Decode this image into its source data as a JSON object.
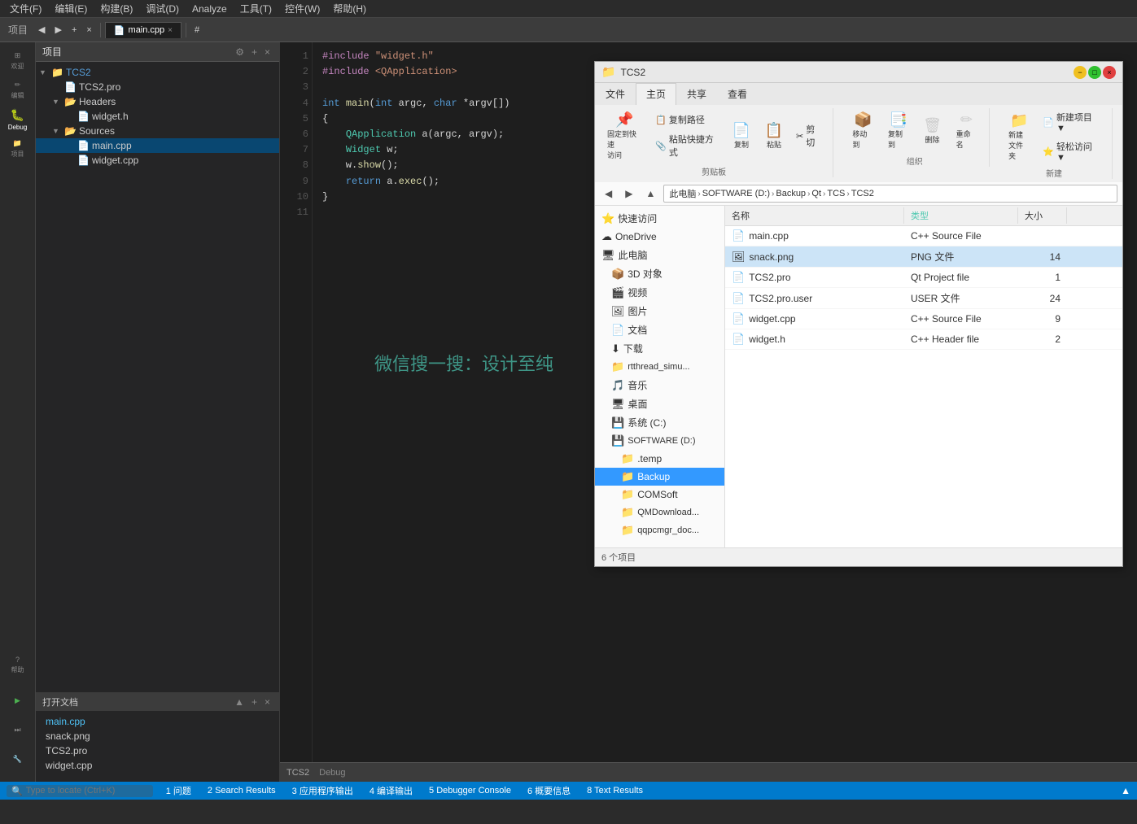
{
  "menubar": {
    "items": [
      "文件(F)",
      "编辑(E)",
      "构建(B)",
      "调试(D)",
      "Analyze",
      "工具(T)",
      "控件(W)",
      "帮助(H)"
    ]
  },
  "toolbar": {
    "project_label": "项目",
    "file_tab": "main.cpp",
    "search_placeholder": "⊕"
  },
  "project_panel": {
    "title": "项目",
    "root": "TCS2",
    "tree": [
      {
        "label": "TCS2",
        "type": "project",
        "depth": 0,
        "expanded": true
      },
      {
        "label": "TCS2.pro",
        "type": "pro",
        "depth": 1
      },
      {
        "label": "Headers",
        "type": "folder",
        "depth": 1,
        "expanded": true
      },
      {
        "label": "widget.h",
        "type": "header",
        "depth": 2
      },
      {
        "label": "Sources",
        "type": "folder",
        "depth": 1,
        "expanded": true
      },
      {
        "label": "main.cpp",
        "type": "source",
        "depth": 2
      },
      {
        "label": "widget.cpp",
        "type": "source",
        "depth": 2
      }
    ]
  },
  "editor": {
    "tab": "main.cpp",
    "lines": [
      1,
      2,
      3,
      4,
      5,
      6,
      7,
      8,
      9,
      10,
      11
    ],
    "code": [
      "#include \"widget.h\"",
      "#include <QApplication>",
      "",
      "int main(int argc, char *argv[])",
      "{",
      "    QApplication a(argc, argv);",
      "    Widget w;",
      "    w.show();",
      "    return a.exec();",
      "}",
      ""
    ]
  },
  "open_docs": {
    "title": "打开文档",
    "items": [
      "main.cpp",
      "snack.png",
      "TCS2.pro",
      "widget.cpp"
    ]
  },
  "bottom_toolbar": {
    "items": [
      "TCS2",
      "Debug"
    ]
  },
  "statusbar": {
    "search_placeholder": "Type to locate (Ctrl+K)",
    "items": [
      "1 问题",
      "2 Search Results",
      "3 应用程序输出",
      "4 编译输出",
      "5 Debugger Console",
      "6 概要信息",
      "8 Text Results"
    ]
  },
  "explorer": {
    "title": "TCS2",
    "breadcrumb": [
      "此电脑",
      "SOFTWARE (D:)",
      "Backup",
      "Qt",
      "TCS",
      "TCS2"
    ],
    "ribbon_tabs": [
      "文件",
      "主页",
      "共享",
      "查看"
    ],
    "active_ribbon_tab": "主页",
    "ribbon_groups": {
      "clipboard": {
        "label": "剪贴板",
        "buttons": [
          "固定到快速访问",
          "复制",
          "粘贴",
          "复制路径",
          "粘贴快捷方式",
          "剪切"
        ]
      },
      "organize": {
        "label": "组织",
        "buttons": [
          "移动到",
          "复制到",
          "删除",
          "重命名"
        ]
      },
      "new": {
        "label": "新建",
        "buttons": [
          "新建项目▼",
          "轻松访问▼",
          "新建文件夹"
        ]
      }
    },
    "sidebar_items": [
      {
        "label": "快速访问",
        "icon": "⭐",
        "depth": 0
      },
      {
        "label": "OneDrive",
        "icon": "☁",
        "depth": 0
      },
      {
        "label": "此电脑",
        "icon": "🖥",
        "depth": 0
      },
      {
        "label": "3D 对象",
        "icon": "📦",
        "depth": 1
      },
      {
        "label": "视频",
        "icon": "🎬",
        "depth": 1
      },
      {
        "label": "图片",
        "icon": "🖼",
        "depth": 1
      },
      {
        "label": "文档",
        "icon": "📄",
        "depth": 1
      },
      {
        "label": "下载",
        "icon": "⬇",
        "depth": 1
      },
      {
        "label": "rtthread_simu...",
        "icon": "📁",
        "depth": 1
      },
      {
        "label": "音乐",
        "icon": "🎵",
        "depth": 1
      },
      {
        "label": "桌面",
        "icon": "🖥",
        "depth": 1
      },
      {
        "label": "系统 (C:)",
        "icon": "💾",
        "depth": 1
      },
      {
        "label": "SOFTWARE (D:)",
        "icon": "💾",
        "depth": 1
      },
      {
        "label": ".temp",
        "icon": "📁",
        "depth": 2
      },
      {
        "label": "Backup",
        "icon": "📁",
        "depth": 2,
        "selected": true,
        "highlighted": true
      },
      {
        "label": "COMSoft",
        "icon": "📁",
        "depth": 2
      },
      {
        "label": "QMDownload...",
        "icon": "📁",
        "depth": 2
      },
      {
        "label": "qqpcmgr_doc...",
        "icon": "📁",
        "depth": 2
      }
    ],
    "files": [
      {
        "name": "main.cpp",
        "type": "C++ Source File",
        "size": ""
      },
      {
        "name": "snack.png",
        "type": "PNG 文件",
        "size": "14",
        "selected": true
      },
      {
        "name": "TCS2.pro",
        "type": "Qt Project file",
        "size": "1"
      },
      {
        "name": "TCS2.pro.user",
        "type": "USER 文件",
        "size": "24"
      },
      {
        "name": "widget.cpp",
        "type": "C++ Source File",
        "size": "9"
      },
      {
        "name": "widget.h",
        "type": "C++ Header file",
        "size": "2"
      }
    ],
    "statusbar": "6 个项目"
  },
  "watermark": "微信搜一搜：设计至纯",
  "sidebar_icons": [
    {
      "name": "welcome-icon",
      "label": "欢迎",
      "symbol": "⊞"
    },
    {
      "name": "edit-icon",
      "label": "编辑",
      "symbol": "✏"
    },
    {
      "name": "debug-icon",
      "label": "Debug",
      "symbol": "🐛"
    },
    {
      "name": "project-icon",
      "label": "项目",
      "symbol": "📁"
    },
    {
      "name": "help-icon",
      "label": "帮助",
      "symbol": "?"
    }
  ]
}
